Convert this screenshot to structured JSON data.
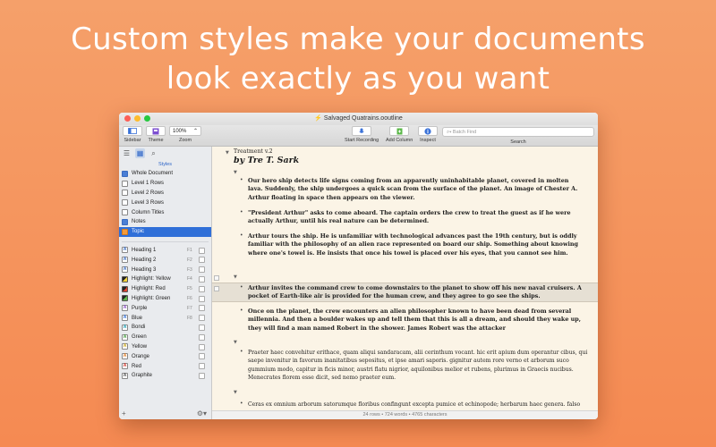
{
  "headline": {
    "line1": "Custom styles make your documents",
    "line2": "look exactly as you want"
  },
  "window": {
    "title": "Salvaged Quatrains.ooutline",
    "toolbar": {
      "sidebar_label": "Sidebar",
      "theme_label": "Theme",
      "zoom_value": "100%",
      "zoom_label": "Zoom",
      "start_recording_label": "Start Recording",
      "add_column_label": "Add Column",
      "inspect_label": "Inspect",
      "search_placeholder": "Batch Find",
      "search_label": "Search"
    },
    "sidebar": {
      "header": "Styles",
      "structure_items": [
        {
          "label": "Whole Document",
          "icon": "blue"
        },
        {
          "label": "Level 1 Rows",
          "icon": "plain"
        },
        {
          "label": "Level 2 Rows",
          "icon": "plain"
        },
        {
          "label": "Level 3 Rows",
          "icon": "plain"
        },
        {
          "label": "Column Titles",
          "icon": "plain"
        },
        {
          "label": "Notes",
          "icon": "blue"
        },
        {
          "label": "Topic",
          "icon": "orange",
          "selected": true
        }
      ],
      "named_styles": [
        {
          "label": "Heading 1",
          "key": "F1",
          "icon": "letter",
          "color": "#3a6cc0"
        },
        {
          "label": "Heading 2",
          "key": "F2",
          "icon": "letter",
          "color": "#3a6cc0"
        },
        {
          "label": "Heading 3",
          "key": "F3",
          "icon": "letter",
          "color": "#3a6cc0"
        },
        {
          "label": "Highlight: Yellow",
          "key": "F4",
          "icon": "diag",
          "color": "#f3d33a"
        },
        {
          "label": "Highlight: Red",
          "key": "F5",
          "icon": "diag",
          "color": "#e0412f"
        },
        {
          "label": "Highlight: Green",
          "key": "F6",
          "icon": "diag",
          "color": "#5cb84a"
        },
        {
          "label": "Purple",
          "key": "F7",
          "icon": "letter",
          "color": "#8a4bc4"
        },
        {
          "label": "Blue",
          "key": "F8",
          "icon": "letter",
          "color": "#2f6fd8"
        },
        {
          "label": "Bondi",
          "key": "",
          "icon": "letter",
          "color": "#1a9bb0"
        },
        {
          "label": "Green",
          "key": "",
          "icon": "letter",
          "color": "#3f9a3a"
        },
        {
          "label": "Yellow",
          "key": "",
          "icon": "letter",
          "color": "#c9a515"
        },
        {
          "label": "Orange",
          "key": "",
          "icon": "letter",
          "color": "#e07a20"
        },
        {
          "label": "Red",
          "key": "",
          "icon": "letter",
          "color": "#d0342a"
        },
        {
          "label": "Graphite",
          "key": "",
          "icon": "letter",
          "color": "#555555"
        }
      ],
      "icon_letter": "A",
      "footer_add": "+",
      "footer_gear": "⚙▾"
    },
    "document": {
      "title": "Treatment v.2",
      "byline": "by Tre T. Sark",
      "paragraphs": [
        "Our hero ship detects life signs coming from an apparently uninhabitable planet, covered in molten lava. Suddenly, the ship undergoes a quick scan from the surface of the planet. An image of Chester A. Arthur floating in space then appears on the viewer.",
        "\"President Arthur\" asks to come aboard. The captain orders the crew to treat the guest as if he were actually Arthur, until his real nature can be determined.",
        "Arthur tours the ship. He is unfamiliar with technological advances past the 19th century, but is oddly familiar with the philosophy of an alien race represented on board our ship. Something about knowing where one's towel is. He insists that once his towel is placed over his eyes, that you cannot see him.",
        "Arthur invites the command crew to come downstairs to the planet to show off his new naval cruisers. A pocket of Earth-like air is provided for the human crew, and they agree to go see the ships.",
        "Once on the planet, the crew encounters an alien philosopher known to have been dead from several millennia. And then a boulder wakes up and tell them that this is all a dream, and should they wake up, they will find a man named Robert in the shower. James Robert was the attacker",
        "Praeter haec convehitur erithace, quam aliqui sandaracam, alii cerinthum vocant. hic erit apium dum operantur cibus, qui saepe invenitur in favorum inanitatibus sepositus, et ipse amari saporis. gignitur autem rore verno et arborum suco gummium modo, capitur in ficis minor, austri flatu nigrior, aquilonibus melior et rubens, plurimus in Graecis nucibus. Menecrates florem esse dicit, sed nemo praeter eum.",
        "Ceras ex omnium arborum satorumque floribus confingunt excepta pumice et echinopode; herbarum haec genera. falso"
      ]
    },
    "status": "24 rows • 724 words • 4765 characters"
  }
}
